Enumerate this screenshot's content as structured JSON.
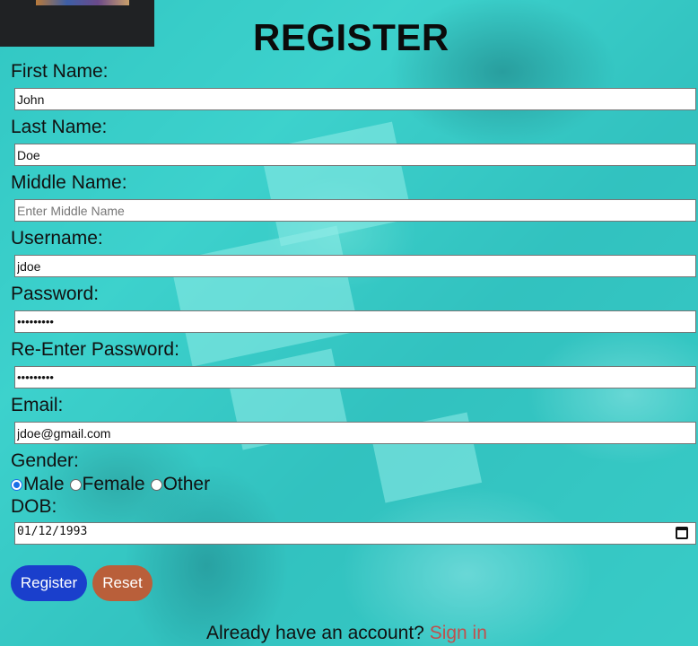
{
  "title": "REGISTER",
  "fields": {
    "first_name": {
      "label": "First Name:",
      "value": "John",
      "placeholder": ""
    },
    "last_name": {
      "label": "Last Name:",
      "value": "Doe",
      "placeholder": ""
    },
    "middle_name": {
      "label": "Middle Name:",
      "value": "",
      "placeholder": "Enter Middle Name"
    },
    "username": {
      "label": "Username:",
      "value": "jdoe",
      "placeholder": ""
    },
    "password": {
      "label": "Password:",
      "value": "•••••••••"
    },
    "reenter_password": {
      "label": "Re-Enter Password:",
      "value": "•••••••••"
    },
    "email": {
      "label": "Email:",
      "value": "jdoe@gmail.com"
    },
    "dob": {
      "label": "DOB:",
      "value": "01/12/1993"
    }
  },
  "gender": {
    "label": "Gender:",
    "options": [
      "Male",
      "Female",
      "Other"
    ],
    "selected": "Male"
  },
  "buttons": {
    "register": "Register",
    "reset": "Reset"
  },
  "footer": {
    "text": "Already have an account?",
    "link": "Sign in"
  },
  "colors": {
    "register_button": "#1a3fcc",
    "reset_button": "#b95f3a",
    "link": "#c0504d",
    "radio_selected": "#1a6ee8"
  }
}
